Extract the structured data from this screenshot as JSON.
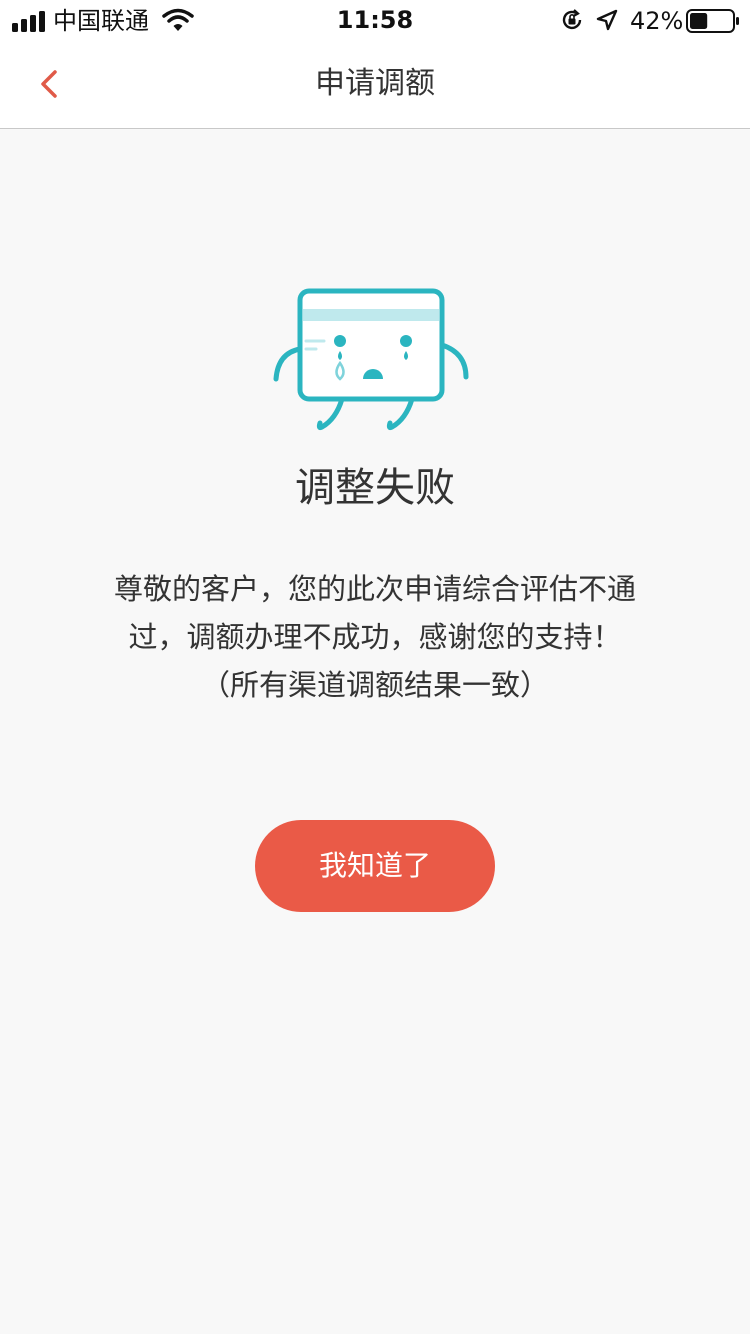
{
  "status_bar": {
    "carrier": "中国联通",
    "time": "11:58",
    "battery_percent": "42%",
    "battery_level": 0.42,
    "icons": [
      "signal-icon",
      "wifi-icon",
      "rotation-lock-icon",
      "location-icon",
      "battery-icon"
    ]
  },
  "nav": {
    "back_icon": "chevron-left-icon",
    "title": "申请调额"
  },
  "result": {
    "illustration": "crying-card-mascot",
    "title": "调整失败",
    "message_lines": [
      "尊敬的客户，您的此次申请综合评估不通",
      "过，调额办理不成功，感谢您的支持！",
      "（所有渠道调额结果一致）"
    ]
  },
  "actions": {
    "confirm_label": "我知道了"
  },
  "colors": {
    "accent": "#ea5a47",
    "back_arrow": "#e05a48",
    "mascot_outline": "#2bb5c0",
    "mascot_stripe": "#bfe9ed",
    "background": "#f8f8f8"
  }
}
